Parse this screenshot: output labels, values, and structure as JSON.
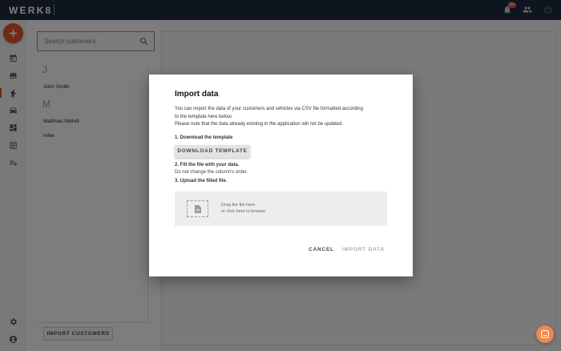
{
  "app": {
    "logo_text": "WERK8",
    "accent_color": "#e0542b",
    "topbar_color": "#1e2b3c"
  },
  "topbar": {
    "notification_badge": "99+",
    "icons": [
      "bell-icon",
      "people-icon",
      "power-icon"
    ]
  },
  "rail": {
    "icons": [
      "calendar-icon",
      "store-icon",
      "walk-icon",
      "car-icon",
      "dashboard-icon",
      "table-icon",
      "list-icon",
      "settings-icon",
      "account-icon"
    ],
    "active": "walk-icon"
  },
  "customers": {
    "search_placeholder": "Search customers",
    "groups": [
      {
        "letter": "J",
        "names": [
          "John Smith"
        ]
      },
      {
        "letter": "M",
        "names": [
          "Matthias Wehrli",
          "mike"
        ]
      }
    ],
    "import_button": "IMPORT CUSTOMERS"
  },
  "modal": {
    "title": "Import data",
    "intro": "You can import the data of your customers and vehicles via CSV file formatted according\nto the template here below.\nPlease note that the data already existing in the application will not be updated.",
    "step1": "1. Download the template",
    "download_button": "DOWNLOAD TEMPLATE",
    "step2": "2. Fill the file with your data.",
    "step2_note": "Do not change the column's order.",
    "step3": "3. Upload the filled file.",
    "dropzone_text": "Drag the file here\nor click here to browse",
    "cancel_button": "CANCEL",
    "import_button": "IMPORT DATA"
  }
}
